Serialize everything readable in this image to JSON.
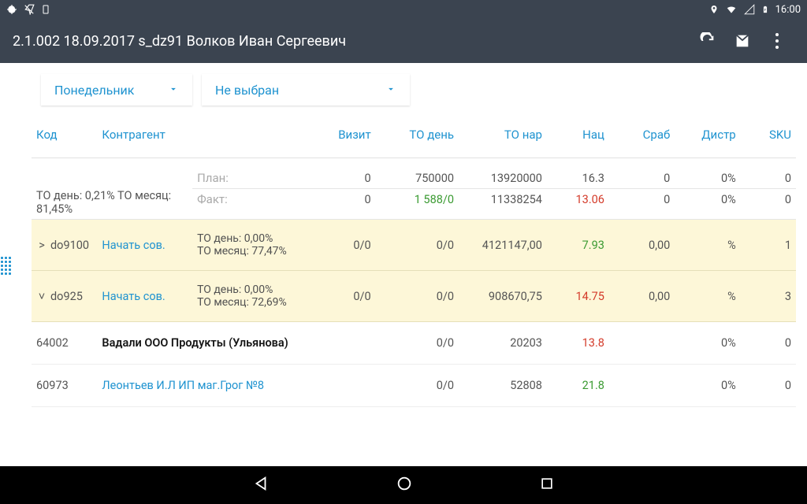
{
  "status": {
    "time": "16:00"
  },
  "appbar": {
    "title": "2.1.002 18.09.2017 s_dz91 Волков Иван Сергеевич"
  },
  "dropdowns": {
    "day": "Понедельник",
    "filter": "Не выбран"
  },
  "columns": {
    "code": "Код",
    "contr": "Контрагент",
    "visit": "Визит",
    "today": "ТО день",
    "tonar": "ТО нар",
    "nats": "Нац",
    "srab": "Сраб",
    "distr": "Дистр",
    "sku": "SKU"
  },
  "summary": {
    "to_line": "ТО день: 0,21%  ТО месяц: 81,45%",
    "plan_label": "План:",
    "fact_label": "Факт:",
    "plan": {
      "visit": "0",
      "today": "750000",
      "tonar": "13920000",
      "nats": "16.3",
      "srab": "0",
      "distr": "0%",
      "sku": "0"
    },
    "fact": {
      "visit": "0",
      "today": "1 588/0",
      "tonar": "11338254",
      "nats": "13.06",
      "srab": "0",
      "distr": "0%",
      "sku": "0"
    }
  },
  "groups": [
    {
      "exp": ">",
      "code": "do9100",
      "action": "Начать сов.",
      "stats": "ТО день: 0,00%\nТО месяц: 77,47%",
      "visit": "0/0",
      "today": "0/0",
      "tonar": "4121147,00",
      "nats": "7.93",
      "nats_cls": "green",
      "srab": "0,00",
      "distr": "%",
      "sku": "1"
    },
    {
      "exp": "˅",
      "code": "do925",
      "action": "Начать сов.",
      "stats": "ТО день: 0,00%\nТО месяц: 72,69%",
      "visit": "0/0",
      "today": "0/0",
      "tonar": "908670,75",
      "nats": "14.75",
      "nats_cls": "red",
      "srab": "0,00",
      "distr": "%",
      "sku": "3"
    }
  ],
  "rows": [
    {
      "code": "64002",
      "name": "Вадали ООО Продукты (Ульянова)",
      "visit": "",
      "today": "0/0",
      "tonar": "20203",
      "nats": "13.8",
      "nats_cls": "red",
      "srab": "",
      "distr": "0%",
      "sku": "0",
      "bold": true
    },
    {
      "code": "60973",
      "name": "Леонтьев И.Л ИП маг.Грог №8",
      "visit": "",
      "today": "0/0",
      "tonar": "52808",
      "nats": "21.8",
      "nats_cls": "green",
      "srab": "",
      "distr": "0%",
      "sku": "0",
      "bold": false
    }
  ]
}
